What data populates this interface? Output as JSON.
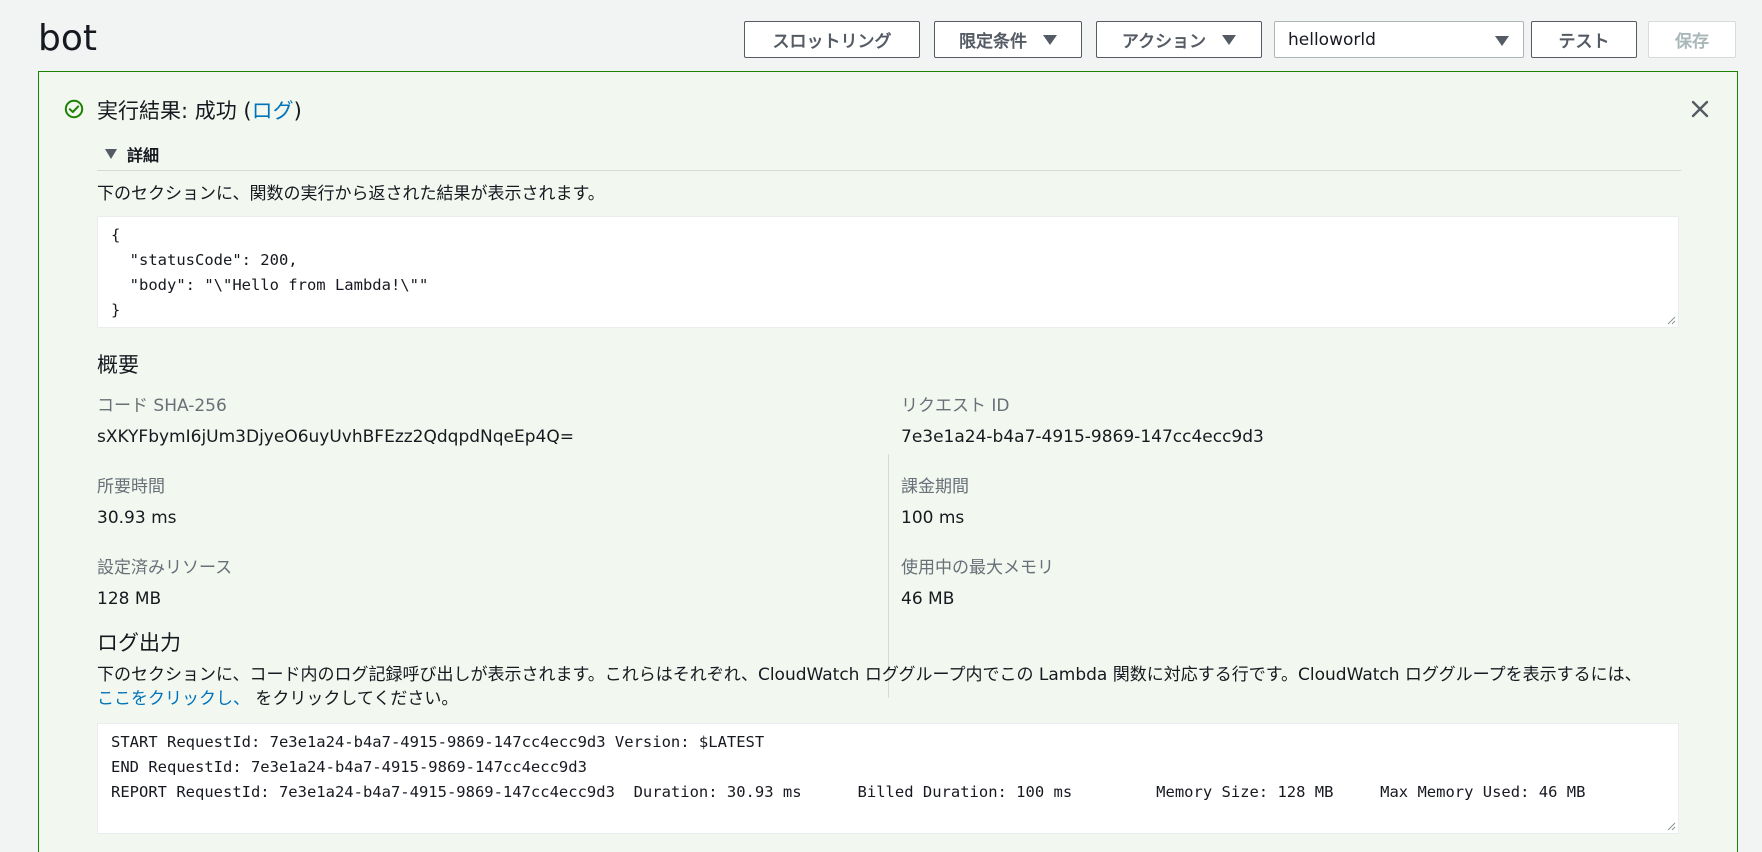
{
  "header": {
    "title": "bot",
    "buttons": {
      "throttling": "スロットリング",
      "qualifiers": "限定条件",
      "actions": "アクション",
      "test": "テスト",
      "save": "保存"
    },
    "test_event_select": "helloworld"
  },
  "result": {
    "status_prefix": "実行結果: 成功 (",
    "status_link": "ログ",
    "status_suffix": ")",
    "details_label": "詳細",
    "output_description": "下のセクションに、関数の実行から返された結果が表示されます。",
    "output_json_lines": [
      "{",
      "  \"statusCode\": 200,",
      "  \"body\": \"\\\"Hello from Lambda!\\\"\"",
      "}"
    ]
  },
  "summary": {
    "heading": "概要",
    "code_sha_label": "コード SHA-256",
    "code_sha_value": "sXKYFbymI6jUm3DjyeO6uyUvhBFEzz2QdqpdNqeEp4Q=",
    "request_id_label": "リクエスト ID",
    "request_id_value": "7e3e1a24-b4a7-4915-9869-147cc4ecc9d3",
    "duration_label": "所要時間",
    "duration_value": "30.93 ms",
    "billed_duration_label": "課金期間",
    "billed_duration_value": "100 ms",
    "resources_label": "設定済みリソース",
    "resources_value": "128 MB",
    "max_memory_label": "使用中の最大メモリ",
    "max_memory_value": "46 MB"
  },
  "log_output": {
    "heading": "ログ出力",
    "description": "下のセクションに、コード内のログ記録呼び出しが表示されます。これらはそれぞれ、CloudWatch ロググループ内でこの Lambda 関数に対応する行です。CloudWatch ロググループを表示するには、",
    "click_here_link": "ここをクリックし、",
    "description_tail": " をクリックしてください。",
    "log_lines": [
      "START RequestId: 7e3e1a24-b4a7-4915-9869-147cc4ecc9d3 Version: $LATEST",
      "END RequestId: 7e3e1a24-b4a7-4915-9869-147cc4ecc9d3",
      "REPORT RequestId: 7e3e1a24-b4a7-4915-9869-147cc4ecc9d3  Duration: 30.93 ms      Billed Duration: 100 ms         Memory Size: 128 MB     Max Memory Used: 46 MB"
    ]
  },
  "colors": {
    "success_green": "#1d8102",
    "panel_background": "#f2f8f0",
    "link_blue": "#0073bb"
  }
}
